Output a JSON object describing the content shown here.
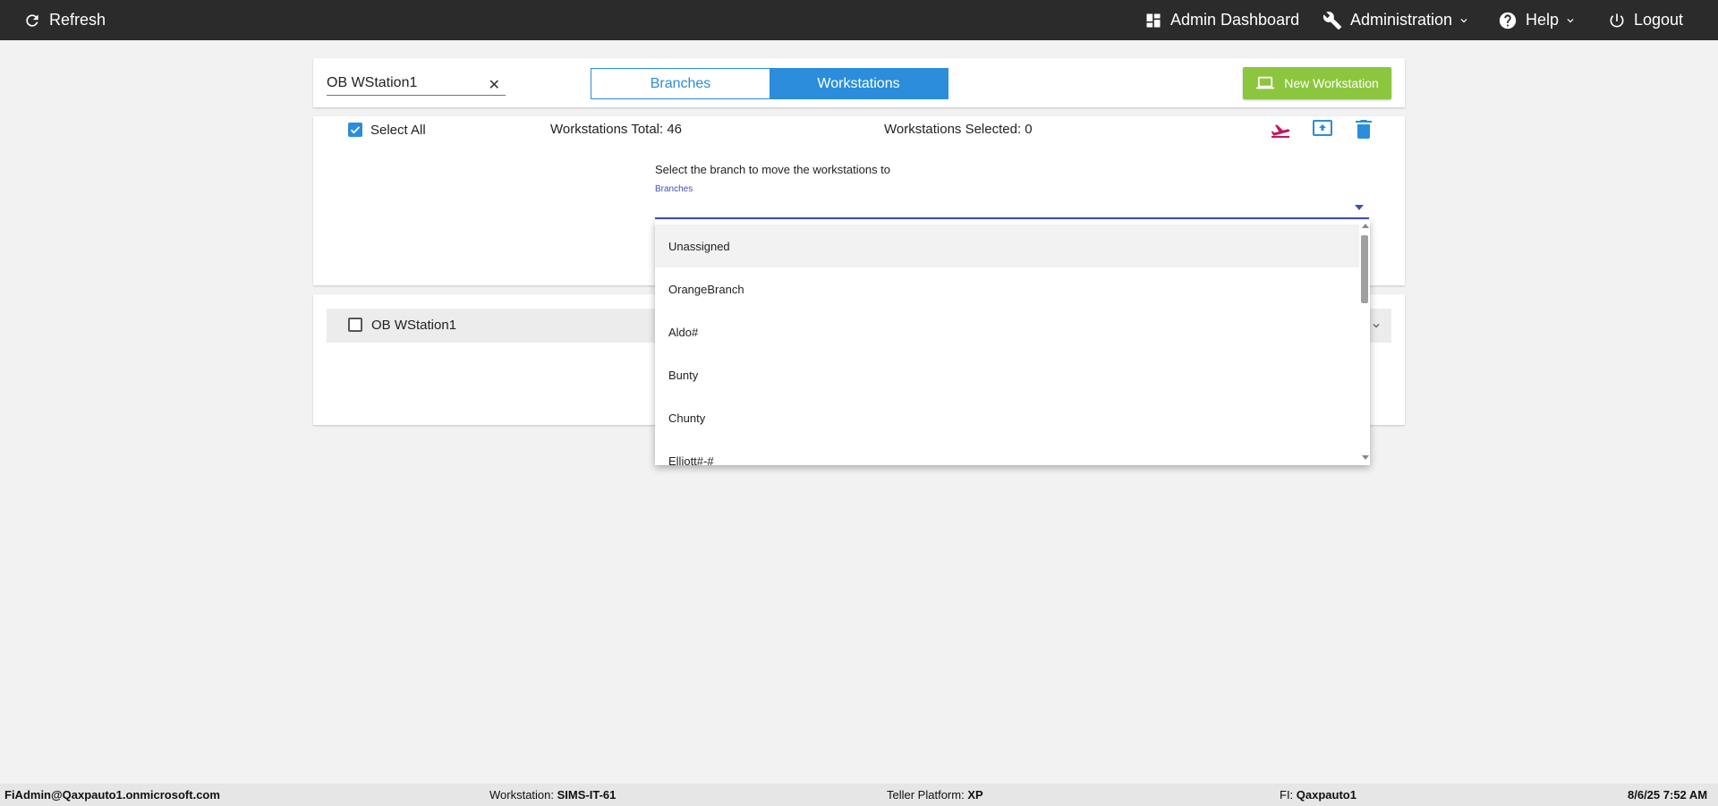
{
  "topbar": {
    "refresh_label": "Refresh",
    "admin_dashboard_label": "Admin Dashboard",
    "administration_label": "Administration",
    "help_label": "Help",
    "logout_label": "Logout"
  },
  "toolbar": {
    "search_value": "OB WStation1",
    "clear_icon": "✕",
    "tabs": [
      {
        "label": "Branches",
        "active": false
      },
      {
        "label": "Workstations",
        "active": true
      }
    ],
    "new_button_label": "New Workstation"
  },
  "selection": {
    "select_all_label": "Select All",
    "select_all_checked": true,
    "total_label": "Workstations Total: 46",
    "selected_label": "Workstations Selected: 0",
    "actions": [
      "move-icon",
      "upload-icon",
      "delete-icon"
    ]
  },
  "move_panel": {
    "instruction": "Select the branch to move the workstations to",
    "field_label": "Branches",
    "options": [
      "Unassigned",
      "OrangeBranch",
      "Aldo#",
      "Bunty",
      "Chunty",
      "Elliott#-#"
    ]
  },
  "list": {
    "rows": [
      {
        "label": "OB WStation1",
        "checked": false
      }
    ]
  },
  "footer": {
    "user": "FiAdmin@Qaxpauto1.onmicrosoft.com",
    "workstation_label": "Workstation:",
    "workstation_value": "SIMS-IT-61",
    "platform_label": "Teller Platform:",
    "platform_value": "XP",
    "fi_label": "FI:",
    "fi_value": "Qaxpauto1",
    "datetime": "8/6/25 7:52 AM"
  },
  "colors": {
    "topbar_bg": "#2b2b2b",
    "accent_blue": "#2b8ddb",
    "new_button_green": "#8cc63f",
    "move_icon_red": "#c2185b",
    "select_underline": "#3f51b5"
  }
}
